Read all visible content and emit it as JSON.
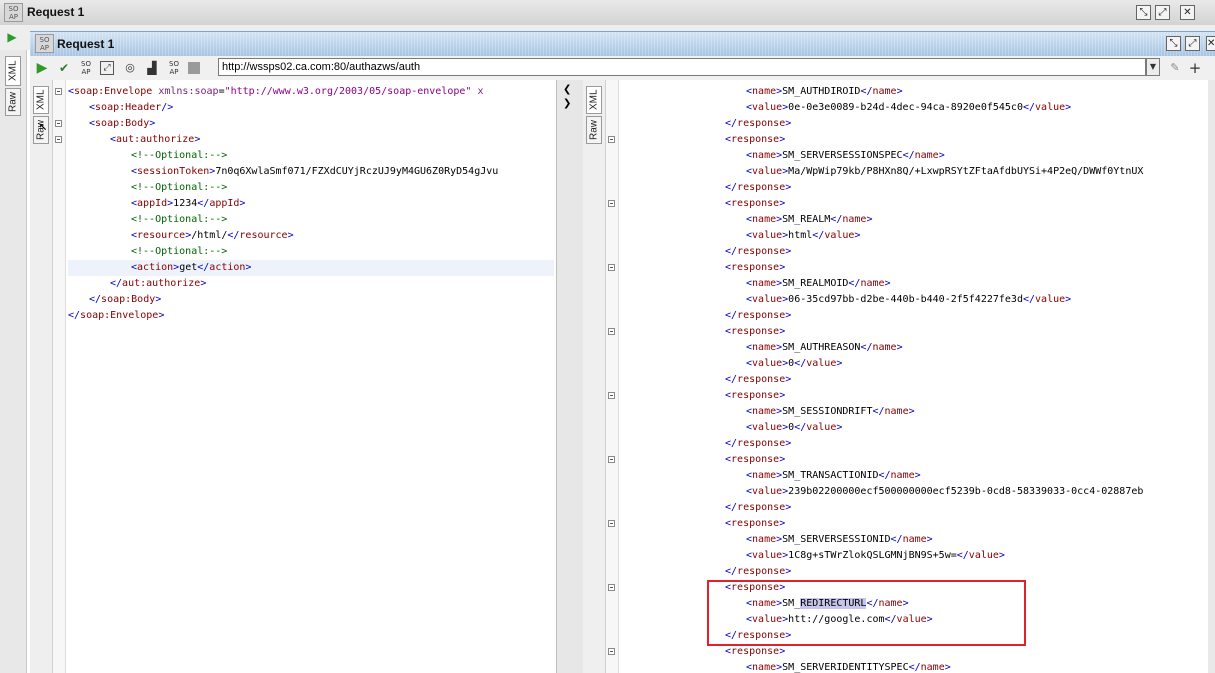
{
  "outer_window": {
    "title": "Request 1",
    "icon_text": "SO AP"
  },
  "inner_window": {
    "title": "Request 1",
    "icon_text": "SO AP"
  },
  "toolbar": {
    "url": "http://wssps02.ca.com:80/authazws/auth",
    "icons": [
      "run-icon",
      "validate-icon",
      "soap-icon",
      "resize-icon",
      "ws-a-icon",
      "soap-small-icon",
      "stop-icon"
    ]
  },
  "tabs": {
    "xml": "XML",
    "raw": "Raw"
  },
  "request_lines": [
    {
      "indent": 0,
      "parts": [
        [
          "br",
          "<"
        ],
        [
          "tag",
          "soap:Envelope"
        ],
        [
          "txt",
          " "
        ],
        [
          "attr",
          "xmlns:soap"
        ],
        [
          "txt",
          "="
        ],
        [
          "str",
          "\"http://www.w3.org/2003/05/soap-envelope\""
        ],
        [
          "txt",
          " "
        ],
        [
          "attr",
          "x"
        ]
      ]
    },
    {
      "indent": 1,
      "parts": [
        [
          "br",
          "<"
        ],
        [
          "tag",
          "soap:Header"
        ],
        [
          "br",
          "/>"
        ]
      ]
    },
    {
      "indent": 1,
      "parts": [
        [
          "br",
          "<"
        ],
        [
          "tag",
          "soap:Body"
        ],
        [
          "br",
          ">"
        ]
      ]
    },
    {
      "indent": 2,
      "parts": [
        [
          "br",
          "<"
        ],
        [
          "tag",
          "aut:authorize"
        ],
        [
          "br",
          ">"
        ]
      ]
    },
    {
      "indent": 3,
      "parts": [
        [
          "cmt",
          "<!--Optional:-->"
        ]
      ]
    },
    {
      "indent": 3,
      "parts": [
        [
          "br",
          "<"
        ],
        [
          "tag",
          "sessionToken"
        ],
        [
          "br",
          ">"
        ],
        [
          "txt",
          "7n0q6XwlaSmf071/FZXdCUYjRczUJ9yM4GU6Z0RyD54gJvu"
        ]
      ]
    },
    {
      "indent": 3,
      "parts": [
        [
          "cmt",
          "<!--Optional:-->"
        ]
      ]
    },
    {
      "indent": 3,
      "parts": [
        [
          "br",
          "<"
        ],
        [
          "tag",
          "appId"
        ],
        [
          "br",
          ">"
        ],
        [
          "txt",
          "1234"
        ],
        [
          "br",
          "</"
        ],
        [
          "tag",
          "appId"
        ],
        [
          "br",
          ">"
        ]
      ]
    },
    {
      "indent": 3,
      "parts": [
        [
          "cmt",
          "<!--Optional:-->"
        ]
      ]
    },
    {
      "indent": 3,
      "parts": [
        [
          "br",
          "<"
        ],
        [
          "tag",
          "resource"
        ],
        [
          "br",
          ">"
        ],
        [
          "txt",
          "/html/"
        ],
        [
          "br",
          "</"
        ],
        [
          "tag",
          "resource"
        ],
        [
          "br",
          ">"
        ]
      ]
    },
    {
      "indent": 3,
      "parts": [
        [
          "cmt",
          "<!--Optional:-->"
        ]
      ]
    },
    {
      "indent": 3,
      "parts": [
        [
          "br",
          "<"
        ],
        [
          "tag",
          "action"
        ],
        [
          "br",
          ">"
        ],
        [
          "txt",
          "get"
        ],
        [
          "br",
          "</"
        ],
        [
          "tag",
          "action"
        ],
        [
          "br",
          ">"
        ]
      ]
    },
    {
      "indent": 2,
      "parts": [
        [
          "br",
          "</"
        ],
        [
          "tag",
          "aut:authorize"
        ],
        [
          "br",
          ">"
        ]
      ]
    },
    {
      "indent": 1,
      "parts": [
        [
          "br",
          "</"
        ],
        [
          "tag",
          "soap:Body"
        ],
        [
          "br",
          ">"
        ]
      ]
    },
    {
      "indent": 0,
      "parts": [
        [
          "br",
          "</"
        ],
        [
          "tag",
          "soap:Envelope"
        ],
        [
          "br",
          ">"
        ]
      ]
    }
  ],
  "response_lines": [
    {
      "indent": 2,
      "parts": [
        [
          "br",
          "<"
        ],
        [
          "tag",
          "name"
        ],
        [
          "br",
          ">"
        ],
        [
          "txt",
          "SM_AUTHDIROID"
        ],
        [
          "br",
          "</"
        ],
        [
          "tag",
          "name"
        ],
        [
          "br",
          ">"
        ]
      ]
    },
    {
      "indent": 2,
      "parts": [
        [
          "br",
          "<"
        ],
        [
          "tag",
          "value"
        ],
        [
          "br",
          ">"
        ],
        [
          "txt",
          "0e-0e3e0089-b24d-4dec-94ca-8920e0f545c0"
        ],
        [
          "br",
          "</"
        ],
        [
          "tag",
          "value"
        ],
        [
          "br",
          ">"
        ]
      ]
    },
    {
      "indent": 1,
      "parts": [
        [
          "br",
          "</"
        ],
        [
          "tag",
          "response"
        ],
        [
          "br",
          ">"
        ]
      ]
    },
    {
      "indent": 1,
      "parts": [
        [
          "br",
          "<"
        ],
        [
          "tag",
          "response"
        ],
        [
          "br",
          ">"
        ]
      ]
    },
    {
      "indent": 2,
      "parts": [
        [
          "br",
          "<"
        ],
        [
          "tag",
          "name"
        ],
        [
          "br",
          ">"
        ],
        [
          "txt",
          "SM_SERVERSESSIONSPEC"
        ],
        [
          "br",
          "</"
        ],
        [
          "tag",
          "name"
        ],
        [
          "br",
          ">"
        ]
      ]
    },
    {
      "indent": 2,
      "parts": [
        [
          "br",
          "<"
        ],
        [
          "tag",
          "value"
        ],
        [
          "br",
          ">"
        ],
        [
          "txt",
          "Ma/WpWip79kb/P8HXn8Q/+LxwpRSYtZFtaAfdbUYSi+4P2eQ/DWWf0YtnUX"
        ]
      ]
    },
    {
      "indent": 1,
      "parts": [
        [
          "br",
          "</"
        ],
        [
          "tag",
          "response"
        ],
        [
          "br",
          ">"
        ]
      ]
    },
    {
      "indent": 1,
      "parts": [
        [
          "br",
          "<"
        ],
        [
          "tag",
          "response"
        ],
        [
          "br",
          ">"
        ]
      ]
    },
    {
      "indent": 2,
      "parts": [
        [
          "br",
          "<"
        ],
        [
          "tag",
          "name"
        ],
        [
          "br",
          ">"
        ],
        [
          "txt",
          "SM_REALM"
        ],
        [
          "br",
          "</"
        ],
        [
          "tag",
          "name"
        ],
        [
          "br",
          ">"
        ]
      ]
    },
    {
      "indent": 2,
      "parts": [
        [
          "br",
          "<"
        ],
        [
          "tag",
          "value"
        ],
        [
          "br",
          ">"
        ],
        [
          "txt",
          "html"
        ],
        [
          "br",
          "</"
        ],
        [
          "tag",
          "value"
        ],
        [
          "br",
          ">"
        ]
      ]
    },
    {
      "indent": 1,
      "parts": [
        [
          "br",
          "</"
        ],
        [
          "tag",
          "response"
        ],
        [
          "br",
          ">"
        ]
      ]
    },
    {
      "indent": 1,
      "parts": [
        [
          "br",
          "<"
        ],
        [
          "tag",
          "response"
        ],
        [
          "br",
          ">"
        ]
      ]
    },
    {
      "indent": 2,
      "parts": [
        [
          "br",
          "<"
        ],
        [
          "tag",
          "name"
        ],
        [
          "br",
          ">"
        ],
        [
          "txt",
          "SM_REALMOID"
        ],
        [
          "br",
          "</"
        ],
        [
          "tag",
          "name"
        ],
        [
          "br",
          ">"
        ]
      ]
    },
    {
      "indent": 2,
      "parts": [
        [
          "br",
          "<"
        ],
        [
          "tag",
          "value"
        ],
        [
          "br",
          ">"
        ],
        [
          "txt",
          "06-35cd97bb-d2be-440b-b440-2f5f4227fe3d"
        ],
        [
          "br",
          "</"
        ],
        [
          "tag",
          "value"
        ],
        [
          "br",
          ">"
        ]
      ]
    },
    {
      "indent": 1,
      "parts": [
        [
          "br",
          "</"
        ],
        [
          "tag",
          "response"
        ],
        [
          "br",
          ">"
        ]
      ]
    },
    {
      "indent": 1,
      "parts": [
        [
          "br",
          "<"
        ],
        [
          "tag",
          "response"
        ],
        [
          "br",
          ">"
        ]
      ]
    },
    {
      "indent": 2,
      "parts": [
        [
          "br",
          "<"
        ],
        [
          "tag",
          "name"
        ],
        [
          "br",
          ">"
        ],
        [
          "txt",
          "SM_AUTHREASON"
        ],
        [
          "br",
          "</"
        ],
        [
          "tag",
          "name"
        ],
        [
          "br",
          ">"
        ]
      ]
    },
    {
      "indent": 2,
      "parts": [
        [
          "br",
          "<"
        ],
        [
          "tag",
          "value"
        ],
        [
          "br",
          ">"
        ],
        [
          "txt",
          "0"
        ],
        [
          "br",
          "</"
        ],
        [
          "tag",
          "value"
        ],
        [
          "br",
          ">"
        ]
      ]
    },
    {
      "indent": 1,
      "parts": [
        [
          "br",
          "</"
        ],
        [
          "tag",
          "response"
        ],
        [
          "br",
          ">"
        ]
      ]
    },
    {
      "indent": 1,
      "parts": [
        [
          "br",
          "<"
        ],
        [
          "tag",
          "response"
        ],
        [
          "br",
          ">"
        ]
      ]
    },
    {
      "indent": 2,
      "parts": [
        [
          "br",
          "<"
        ],
        [
          "tag",
          "name"
        ],
        [
          "br",
          ">"
        ],
        [
          "txt",
          "SM_SESSIONDRIFT"
        ],
        [
          "br",
          "</"
        ],
        [
          "tag",
          "name"
        ],
        [
          "br",
          ">"
        ]
      ]
    },
    {
      "indent": 2,
      "parts": [
        [
          "br",
          "<"
        ],
        [
          "tag",
          "value"
        ],
        [
          "br",
          ">"
        ],
        [
          "txt",
          "0"
        ],
        [
          "br",
          "</"
        ],
        [
          "tag",
          "value"
        ],
        [
          "br",
          ">"
        ]
      ]
    },
    {
      "indent": 1,
      "parts": [
        [
          "br",
          "</"
        ],
        [
          "tag",
          "response"
        ],
        [
          "br",
          ">"
        ]
      ]
    },
    {
      "indent": 1,
      "parts": [
        [
          "br",
          "<"
        ],
        [
          "tag",
          "response"
        ],
        [
          "br",
          ">"
        ]
      ]
    },
    {
      "indent": 2,
      "parts": [
        [
          "br",
          "<"
        ],
        [
          "tag",
          "name"
        ],
        [
          "br",
          ">"
        ],
        [
          "txt",
          "SM_TRANSACTIONID"
        ],
        [
          "br",
          "</"
        ],
        [
          "tag",
          "name"
        ],
        [
          "br",
          ">"
        ]
      ]
    },
    {
      "indent": 2,
      "parts": [
        [
          "br",
          "<"
        ],
        [
          "tag",
          "value"
        ],
        [
          "br",
          ">"
        ],
        [
          "txt",
          "239b02200000ecf500000000ecf5239b-0cd8-58339033-0cc4-02887eb"
        ]
      ]
    },
    {
      "indent": 1,
      "parts": [
        [
          "br",
          "</"
        ],
        [
          "tag",
          "response"
        ],
        [
          "br",
          ">"
        ]
      ]
    },
    {
      "indent": 1,
      "parts": [
        [
          "br",
          "<"
        ],
        [
          "tag",
          "response"
        ],
        [
          "br",
          ">"
        ]
      ]
    },
    {
      "indent": 2,
      "parts": [
        [
          "br",
          "<"
        ],
        [
          "tag",
          "name"
        ],
        [
          "br",
          ">"
        ],
        [
          "txt",
          "SM_SERVERSESSIONID"
        ],
        [
          "br",
          "</"
        ],
        [
          "tag",
          "name"
        ],
        [
          "br",
          ">"
        ]
      ]
    },
    {
      "indent": 2,
      "parts": [
        [
          "br",
          "<"
        ],
        [
          "tag",
          "value"
        ],
        [
          "br",
          ">"
        ],
        [
          "txt",
          "1C8g+sTWrZlokQSLGMNjBN9S+5w="
        ],
        [
          "br",
          "</"
        ],
        [
          "tag",
          "value"
        ],
        [
          "br",
          ">"
        ]
      ]
    },
    {
      "indent": 1,
      "parts": [
        [
          "br",
          "</"
        ],
        [
          "tag",
          "response"
        ],
        [
          "br",
          ">"
        ]
      ]
    },
    {
      "indent": 1,
      "parts": [
        [
          "br",
          "<"
        ],
        [
          "tag",
          "response"
        ],
        [
          "br",
          ">"
        ]
      ]
    },
    {
      "indent": 2,
      "parts": [
        [
          "br",
          "<"
        ],
        [
          "tag",
          "name"
        ],
        [
          "br",
          ">"
        ],
        [
          "txt",
          "SM_"
        ],
        [
          "hl",
          "REDIRECTURL"
        ],
        [
          "br",
          "</"
        ],
        [
          "tag",
          "name"
        ],
        [
          "br",
          ">"
        ]
      ]
    },
    {
      "indent": 2,
      "parts": [
        [
          "br",
          "<"
        ],
        [
          "tag",
          "value"
        ],
        [
          "br",
          ">"
        ],
        [
          "txt",
          "htt://google.com"
        ],
        [
          "br",
          "</"
        ],
        [
          "tag",
          "value"
        ],
        [
          "br",
          ">"
        ]
      ]
    },
    {
      "indent": 1,
      "parts": [
        [
          "br",
          "</"
        ],
        [
          "tag",
          "response"
        ],
        [
          "br",
          ">"
        ]
      ]
    },
    {
      "indent": 1,
      "parts": [
        [
          "br",
          "<"
        ],
        [
          "tag",
          "response"
        ],
        [
          "br",
          ">"
        ]
      ]
    },
    {
      "indent": 2,
      "parts": [
        [
          "br",
          "<"
        ],
        [
          "tag",
          "name"
        ],
        [
          "br",
          ">"
        ],
        [
          "txt",
          "SM_SERVERIDENTITYSPEC"
        ],
        [
          "br",
          "</"
        ],
        [
          "tag",
          "name"
        ],
        [
          "br",
          ">"
        ]
      ]
    }
  ],
  "colors": {
    "tag": "#880000",
    "bracket": "#0000cc",
    "attr": "#7a1f7a",
    "string": "#8b008b",
    "comment": "#006400",
    "highlight_box": "#e0232a"
  }
}
